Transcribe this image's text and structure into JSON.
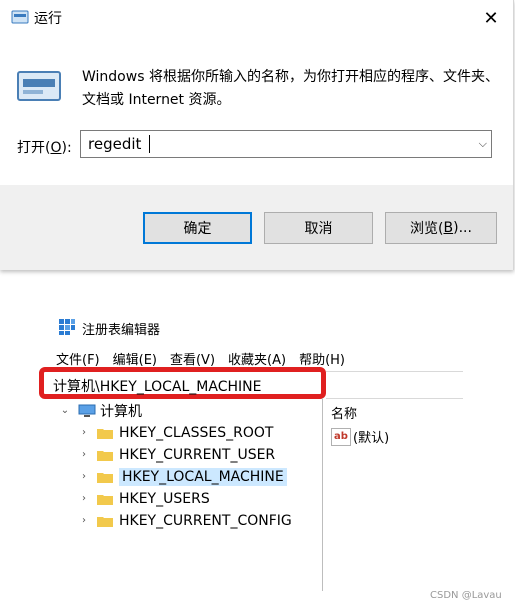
{
  "run_dialog": {
    "title": "运行",
    "description": "Windows 将根据你所输入的名称，为你打开相应的程序、文件夹、文档或 Internet 资源。",
    "open_label_pre": "打开(",
    "open_label_key": "O",
    "open_label_post": "):",
    "input_value": "regedit",
    "ok_label": "确定",
    "cancel_label": "取消",
    "browse_label_pre": "浏览(",
    "browse_label_key": "B",
    "browse_label_post": ")...",
    "close_glyph": "✕"
  },
  "regedit": {
    "title": "注册表编辑器",
    "menu": [
      "文件(F)",
      "编辑(E)",
      "查看(V)",
      "收藏夹(A)",
      "帮助(H)"
    ],
    "address": "计算机\\HKEY_LOCAL_MACHINE",
    "tree_root": "计算机",
    "tree_items": [
      "HKEY_CLASSES_ROOT",
      "HKEY_CURRENT_USER",
      "HKEY_LOCAL_MACHINE",
      "HKEY_USERS",
      "HKEY_CURRENT_CONFIG"
    ],
    "selected_index": 2,
    "list_header": "名称",
    "list_rows": [
      {
        "icon": "ab",
        "name": "(默认)"
      }
    ]
  },
  "watermark": "CSDN @Lavau",
  "colors": {
    "accent": "#0078d7",
    "highlight": "#e02020",
    "selection": "#cce8ff",
    "folder": "#f2c94c"
  }
}
